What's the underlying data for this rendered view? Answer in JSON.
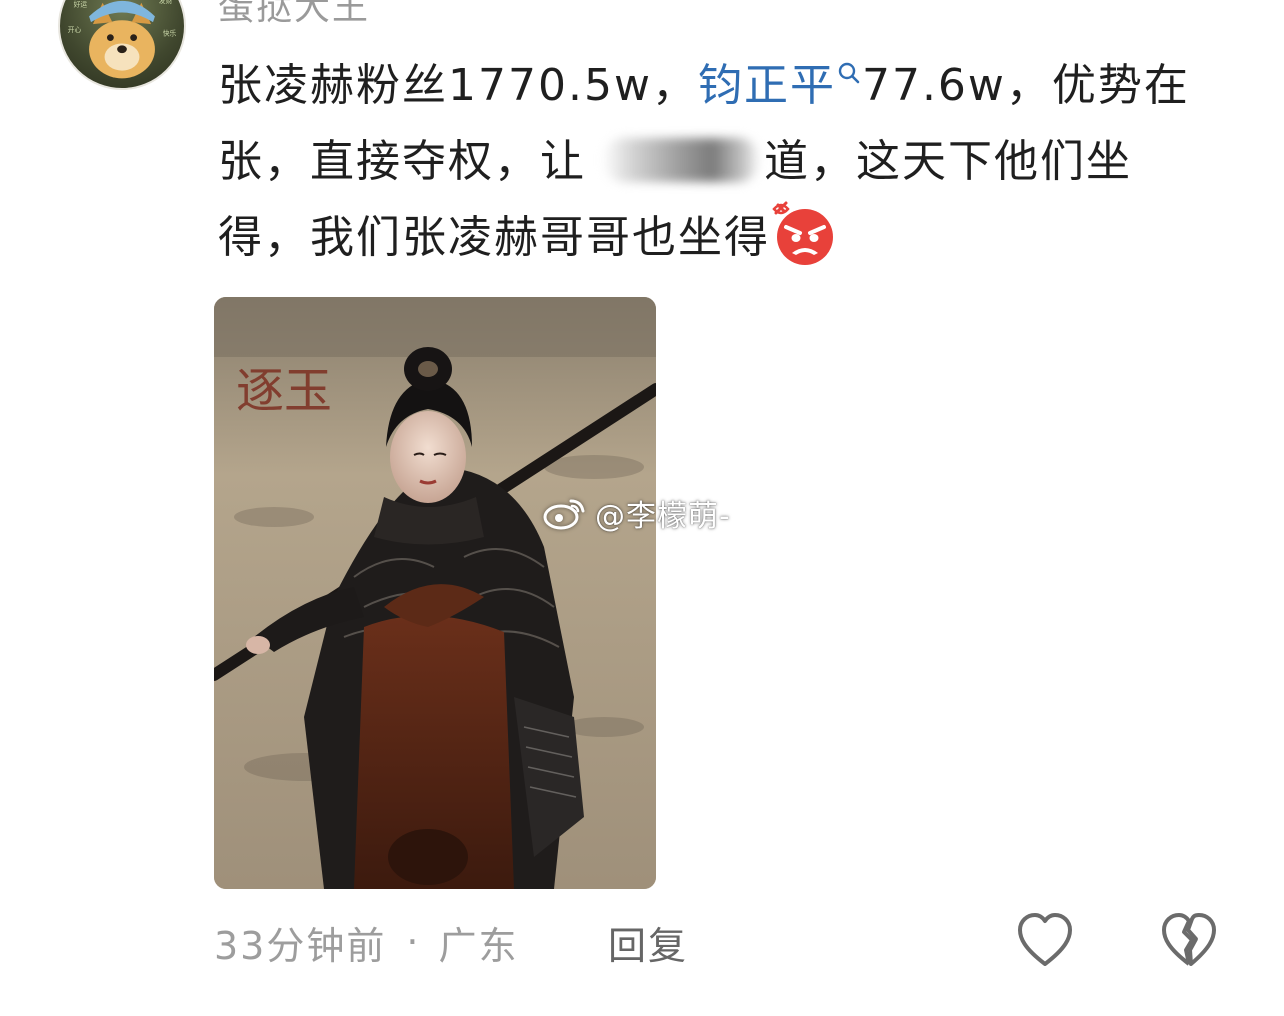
{
  "comment": {
    "username": "蛋挞大王",
    "text": {
      "part1": "张凌赫粉丝1770.5w，",
      "mention": "钧正平",
      "part2": "77.6w，优势在张，直接夺权，让",
      "part3": "道，这天下他们坐得，我们张凌赫哥哥也坐得"
    },
    "emoji": "angry-face",
    "image": {
      "calligraphy": "逐玉",
      "watermark": "@李檬萌-"
    },
    "time": "33分钟前",
    "separator": "·",
    "location": "广东",
    "reply_label": "回复"
  },
  "icons": {
    "search": "search-icon",
    "like": "heart-outline-icon",
    "dislike": "broken-heart-icon",
    "weibo": "weibo-logo-icon"
  },
  "colors": {
    "mention": "#2f6db3",
    "text": "#1f1f1f",
    "meta": "#9d9d9d",
    "emoji_red": "#e8413a"
  }
}
